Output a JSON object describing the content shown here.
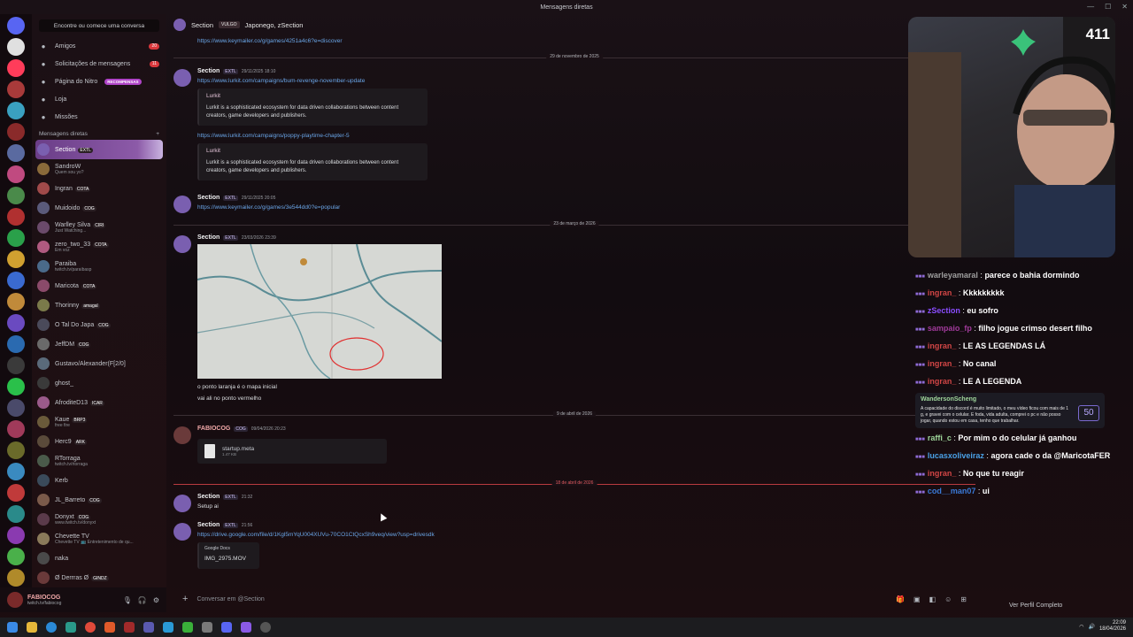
{
  "window": {
    "title": "Mensagens diretas"
  },
  "sidebar": {
    "search_placeholder": "Encontre ou comece uma conversa",
    "nav": [
      {
        "label": "Amigos",
        "count": "20",
        "icon": "friends-icon"
      },
      {
        "label": "Solicitações de mensagens",
        "count": "11",
        "icon": "mail-icon"
      },
      {
        "label": "Página do Nitro",
        "pill": "RECOMPENSAS",
        "icon": "nitro-icon"
      },
      {
        "label": "Loja",
        "icon": "shop-icon"
      },
      {
        "label": "Missões",
        "icon": "quest-icon"
      }
    ],
    "dm_header": "Mensagens diretas",
    "dms": [
      {
        "name": "Section",
        "tag": "EXTL",
        "color": "#7a5fb0"
      },
      {
        "name": "SandroW",
        "sub": "Quem sou yo?",
        "color": "#8a6a3a"
      },
      {
        "name": "Ingran",
        "tag": "COTA",
        "color": "#a04a4a"
      },
      {
        "name": "Muidoido",
        "tag": "COG",
        "color": "#5a5a7a"
      },
      {
        "name": "Warlley Silva",
        "tag": "CIRI",
        "sub": "Just Watching...",
        "color": "#6a4a6a"
      },
      {
        "name": "zero_two_33",
        "tag": "COTA",
        "sub": "Em voz",
        "color": "#b05a80"
      },
      {
        "name": "Paraiba",
        "sub": "twitch.tv/paraibasp",
        "color": "#4a6a8a"
      },
      {
        "name": "Maricota",
        "tag": "COTA",
        "color": "#8a4a6a"
      },
      {
        "name": "Thorinny",
        "tag": "amagal",
        "color": "#7a7a4a"
      },
      {
        "name": "O Tal Do Japa",
        "tag": "COG",
        "color": "#4a4a5a"
      },
      {
        "name": "JeffDM",
        "tag": "COG",
        "color": "#6a6a6a"
      },
      {
        "name": "Gustavo/Alexander(F[2/0]",
        "sub": "",
        "color": "#5a6a7a"
      },
      {
        "name": "ghost_",
        "color": "#3a3a3a"
      },
      {
        "name": "AfroditeD13",
        "tag": "ICAR",
        "color": "#9a5a8a"
      },
      {
        "name": "Kaue",
        "tag": "BRP3",
        "sub": "free fire",
        "color": "#6a5a3a"
      },
      {
        "name": "Herc9",
        "tag": "ARK",
        "color": "#5a4a3a"
      },
      {
        "name": "RTorraga",
        "sub": "twitch.tv/rtorraga",
        "color": "#4a5a4a"
      },
      {
        "name": "Kerb",
        "color": "#3a4a5a"
      },
      {
        "name": "JL_Barreto",
        "tag": "COG",
        "color": "#7a5a4a"
      },
      {
        "name": "Donyxt",
        "tag": "COG",
        "sub": "www.twitch.tv/donyxt",
        "color": "#5a3a4a"
      },
      {
        "name": "Chevette TV",
        "sub": "Chevette TV 📺 Entretenimento de qu...",
        "color": "#8a7a5a"
      },
      {
        "name": "naka",
        "color": "#4a4a4a"
      },
      {
        "name": "Ø Derrras Ø",
        "tag": "GINDZ",
        "color": "#6a3a3a"
      }
    ],
    "user": {
      "name": "FABIOCOG",
      "status": "twitch.tv/fabiocog"
    }
  },
  "chat_header": {
    "name": "Section",
    "vulgo": "VULGO",
    "aka": "Japonego, zSection"
  },
  "messages": {
    "link0": "https://www.keymailer.co/g/games/4251a4c6?e=discover",
    "div1": "29 de novembro de 2025",
    "m1": {
      "author": "Section",
      "badge": "EXTL",
      "time": "29/11/2025 18:10",
      "link1": "https://www.lurkit.com/campaigns/bum-revenge-november-update",
      "embed_title": "Lurkit",
      "embed_desc": "Lurkit is a sophisticated ecosystem for data driven collaborations between content creators, game developers and publishers.",
      "link2": "https://www.lurkit.com/campaigns/poppy-playtime-chapter-5"
    },
    "m2": {
      "author": "Section",
      "badge": "EXTL",
      "time": "29/11/2025 20:05",
      "link": "https://www.keymailer.co/g/games/3e544dd0?e=popular"
    },
    "div2": "23 de março de 2026",
    "m3": {
      "author": "Section",
      "badge": "EXTL",
      "time": "23/03/2026 23:39",
      "line1": "o ponto laranja é o mapa inicial",
      "line2": "vai ali no ponto vermelho"
    },
    "div3": "9 de abril de 2026",
    "m4": {
      "author": "FABIOCOG",
      "badge": "COG",
      "time": "09/04/2026 20:23",
      "file": "startup.meta",
      "size": "1.47 KB"
    },
    "div4": "18 de abril de 2026",
    "m5": {
      "author": "Section",
      "badge": "EXTL",
      "time": "21:32",
      "text": "Setup ai"
    },
    "m6": {
      "author": "Section",
      "badge": "EXTL",
      "time": "21:56",
      "link": "https://drive.google.com/file/d/1Kgl5mYqU004XUVu-70CO1CtQcxSh9veq/view?usp=drivesdk",
      "doc_source": "Google Docs",
      "doc_name": "IMG_2975.MOV"
    }
  },
  "composer": {
    "placeholder": "Conversar em @Section"
  },
  "stream": {
    "viewers": "411",
    "chat": [
      {
        "user": "warleyamaral",
        "color": "#9e9e9e",
        "text": "parece o bahia dormindo"
      },
      {
        "user": "ingran_",
        "color": "#d04545",
        "text": "Kkkkkkkkk"
      },
      {
        "user": "zSection",
        "color": "#8a4dff",
        "text": "eu sofro"
      },
      {
        "user": "sampaio_fp",
        "color": "#a03a9a",
        "text": "filho jogue crimso desert filho"
      },
      {
        "user": "ingran_",
        "color": "#d04545",
        "text": "LE AS LEGENDAS LÁ"
      },
      {
        "user": "ingran_",
        "color": "#d04545",
        "text": "No canal"
      },
      {
        "user": "ingran_",
        "color": "#d04545",
        "text": "LE A LEGENDA"
      }
    ],
    "highlight": {
      "user": "WandersonScheng",
      "text": "A capacidade do discord é muito limitado, o meu vídeo ficou com mais de 1 g, e gravei com o celular. E foda, vida adulta, comprei o pc e não posso jogar, quando estou em casa, tenho que trabalhar.",
      "amount": "50"
    },
    "chat2": [
      {
        "user": "raffi_c",
        "color": "#9ed59a",
        "text": "Por mim o do celular já ganhou"
      },
      {
        "user": "lucasxoliveiraz",
        "color": "#4aa0e6",
        "text": "agora cade o da @MaricotaFER"
      },
      {
        "user": "ingran_",
        "color": "#d04545",
        "text": "No que tu reagir"
      },
      {
        "user": "cod__man07",
        "color": "#3a7ad8",
        "text": "ui"
      }
    ],
    "profile_button": "Ver Perfil Completo"
  },
  "taskbar": {
    "time": "22:09",
    "date": "18/04/2026"
  }
}
